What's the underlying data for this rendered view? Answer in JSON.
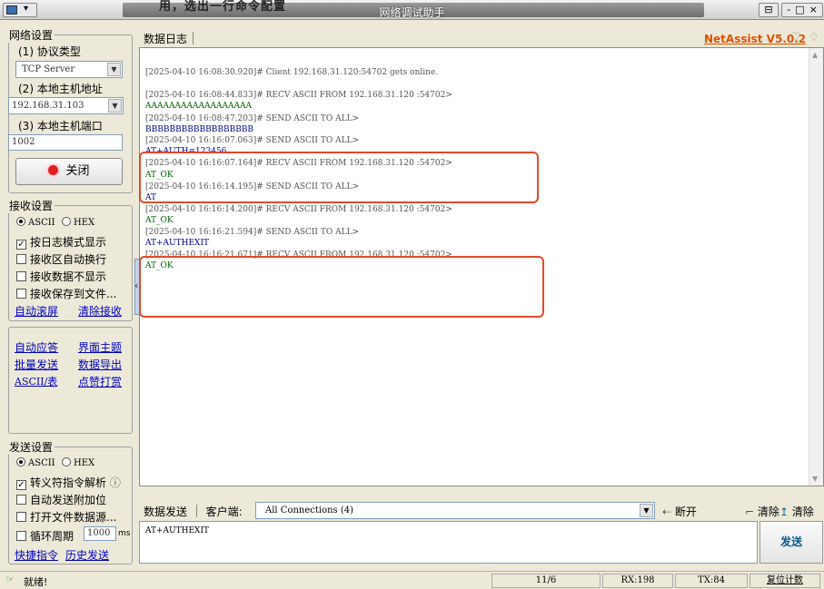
{
  "window": {
    "title_top": "用，选出一行命令配置",
    "title": "网络调试助手",
    "sys_menu": "▾",
    "pin_icon": "⊟",
    "minimize": "-",
    "maximize": "□",
    "close": "×"
  },
  "network": {
    "legend": "网络设置",
    "protocol_label": "(1) 协议类型",
    "protocol_value": "TCP Server",
    "host_label": "(2) 本地主机地址",
    "host_value": "192.168.31.103",
    "port_label": "(3) 本地主机端口",
    "port_value": "1002",
    "close_button": "关闭"
  },
  "receive": {
    "legend": "接收设置",
    "ascii": "ASCII",
    "hex": "HEX",
    "options": [
      "按日志模式显示",
      "接收区自动换行",
      "接收数据不显示",
      "接收保存到文件..."
    ],
    "options_checked": [
      true,
      false,
      false,
      false
    ],
    "link_autoscroll": "自动滚屏",
    "link_clear": "清除接收"
  },
  "tools": {
    "links": [
      "自动应答",
      "界面主题",
      "批量发送",
      "数据导出",
      "ASCII/表",
      "点赞打赏"
    ]
  },
  "send": {
    "legend": "发送设置",
    "ascii": "ASCII",
    "hex": "HEX",
    "escape": "转义符指令解析",
    "escape_info": "ⓘ",
    "options": [
      "自动发送附加位",
      "打开文件数据源...",
      "循环周期"
    ],
    "cycle_value": "1000",
    "cycle_unit": "ms",
    "link_shortcut": "快捷指令",
    "link_history": "历史发送"
  },
  "log": {
    "tab": "数据日志",
    "brand": "NetAssist V5.0.2",
    "lines": [
      {
        "text": "[2025-04-10 16:08:30.920]# Client 192.168.31.120:54702 gets online.",
        "kind": "meta"
      },
      {
        "text": "[2025-04-10 16:08:44.833]# RECV ASCII FROM 192.168.31.120 :54702>",
        "kind": "meta"
      },
      {
        "text": "AAAAAAAAAAAAAAAAAA",
        "kind": "recv"
      },
      {
        "text": "[2025-04-10 16:08:47.203]# SEND ASCII TO ALL>",
        "kind": "meta"
      },
      {
        "text": "BBBBBBBBBBBBBBBBBB",
        "kind": "sent"
      },
      {
        "text": "[2025-04-10 16:16:07.063]# SEND ASCII TO ALL>",
        "kind": "meta"
      },
      {
        "text": "AT+AUTH=123456",
        "kind": "sent"
      },
      {
        "text": "[2025-04-10 16:16:07.164]# RECV ASCII FROM 192.168.31.120 :54702>",
        "kind": "meta"
      },
      {
        "text": "AT_OK",
        "kind": "recv"
      },
      {
        "text": "[2025-04-10 16:16:14.195]# SEND ASCII TO ALL>",
        "kind": "meta"
      },
      {
        "text": "AT",
        "kind": "sent"
      },
      {
        "text": "[2025-04-10 16:16:14.200]# RECV ASCII FROM 192.168.31.120 :54702>",
        "kind": "meta"
      },
      {
        "text": "AT_OK",
        "kind": "recv"
      },
      {
        "text": "[2025-04-10 16:16:21.594]# SEND ASCII TO ALL>",
        "kind": "meta"
      },
      {
        "text": "AT+AUTHEXIT",
        "kind": "sent"
      },
      {
        "text": "[2025-04-10 16:16:21.671]# RECV ASCII FROM 192.168.31.120 :54702>",
        "kind": "meta"
      },
      {
        "text": "AT_OK",
        "kind": "recv"
      }
    ]
  },
  "sendbar": {
    "tab_send": "数据发送",
    "tab_client": "客户端:",
    "connections": "All Connections (4)",
    "disconnect": "断开",
    "clear1": "清除",
    "clear2": "清除",
    "input": "AT+AUTHEXIT",
    "send_button": "发送"
  },
  "status": {
    "ready": "就绪!",
    "count": "11/6",
    "rx": "RX:198",
    "tx": "TX:84",
    "reset": "复位计数"
  },
  "colors": {
    "highlight": "#e04b2b",
    "brand": "#e05000",
    "link": "#0000c0"
  }
}
